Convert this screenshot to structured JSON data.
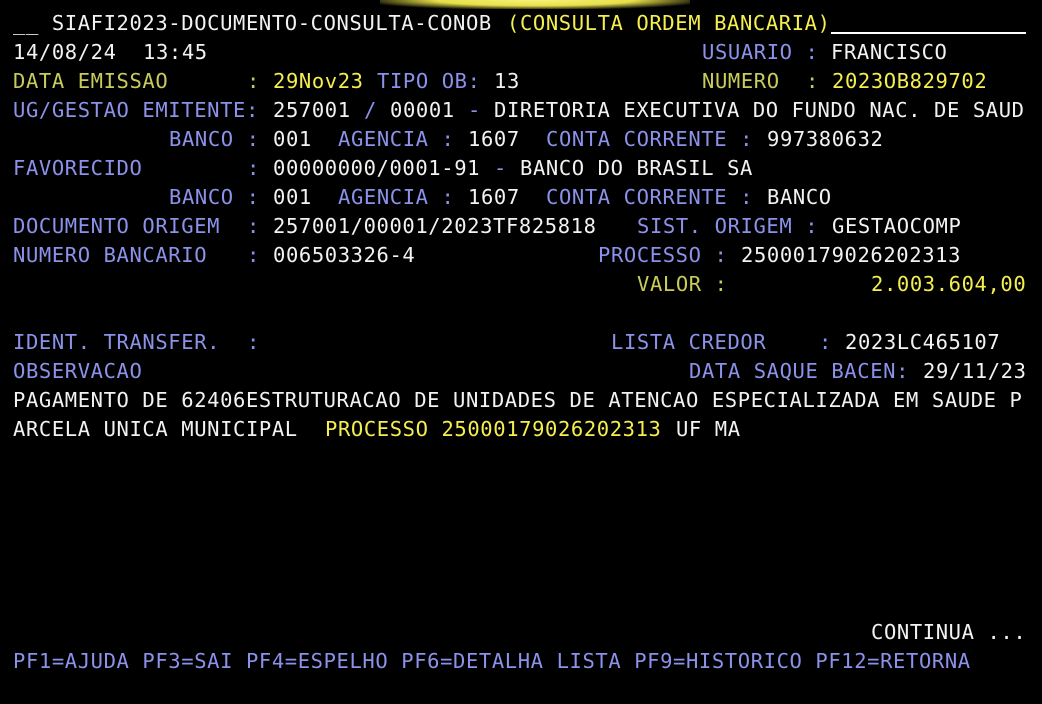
{
  "header": {
    "title_prefix": "__ SIAFI2023-DOCUMENTO-CONSULTA-CONOB ",
    "title_highlight": "(CONSULTA ORDEM BANCARIA)",
    "date": "14/08/24",
    "time": "13:45",
    "usuario_label": "USUARIO :",
    "usuario_value": "FRANCISCO"
  },
  "emissao": {
    "data_label": "DATA EMISSAO",
    "data_colon": ":",
    "data_value": "29Nov23",
    "tipo_label": "TIPO OB:",
    "tipo_value": "13",
    "numero_label": "NUMERO",
    "numero_colon": ":",
    "numero_value": "2023OB829702"
  },
  "emitente": {
    "label": "UG/GESTAO EMITENTE:",
    "ug": "257001",
    "slash": "/",
    "gestao": "00001",
    "dash": "-",
    "nome": "DIRETORIA EXECUTIVA DO FUNDO NAC. DE SAUD",
    "banco_label": "BANCO :",
    "banco_value": "001",
    "agencia_label": "AGENCIA :",
    "agencia_value": "1607",
    "conta_label": "CONTA CORRENTE :",
    "conta_value": "997380632"
  },
  "favorecido": {
    "label": "FAVORECIDO",
    "colon": ":",
    "cnpj": "00000000/0001-91",
    "dash": "-",
    "nome": "BANCO DO BRASIL SA",
    "banco_label": "BANCO :",
    "banco_value": "001",
    "agencia_label": "AGENCIA :",
    "agencia_value": "1607",
    "conta_label": "CONTA CORRENTE :",
    "conta_value": "BANCO"
  },
  "documento": {
    "origem_label": "DOCUMENTO ORIGEM",
    "origem_colon": ":",
    "origem_value": "257001/00001/2023TF825818",
    "sist_label": "SIST. ORIGEM :",
    "sist_value": "GESTAOCOMP",
    "numero_bancario_label": "NUMERO BANCARIO",
    "numero_bancario_colon": ":",
    "numero_bancario_value": "006503326-4",
    "processo_label": "PROCESSO :",
    "processo_value": "25000179026202313",
    "valor_label": "VALOR :",
    "valor_value": "2.003.604,00"
  },
  "transfer": {
    "ident_label": "IDENT. TRANSFER.",
    "ident_colon": ":",
    "lista_label": "LISTA CREDOR",
    "lista_colon": ":",
    "lista_value": "2023LC465107",
    "observacao_label": "OBSERVACAO",
    "saque_label": "DATA SAQUE BACEN:",
    "saque_value": "29/11/23"
  },
  "observacao": {
    "line1": "PAGAMENTO DE 62406ESTRUTURACAO DE UNIDADES DE ATENCAO ESPECIALIZADA EM SAUDE P",
    "line2_start": "ARCELA UNICA MUNICIPAL  ",
    "line2_highlight": "PROCESSO 25000179026202313",
    "line2_end": " UF MA"
  },
  "footer": {
    "continua": "CONTINUA ...",
    "pf_keys": "PF1=AJUDA PF3=SAI PF4=ESPELHO PF6=DETALHA LISTA PF9=HISTORICO PF12=RETORNA"
  },
  "colors": {
    "background": "#000000",
    "text": "#f2f2f2",
    "label_blue": "#8c92ea",
    "highlight_yellow": "#f4ef4e",
    "olive_label": "#c9cc5a"
  }
}
